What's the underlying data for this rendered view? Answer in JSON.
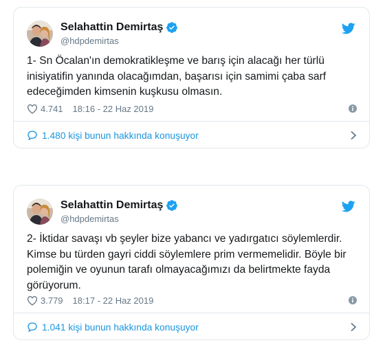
{
  "colors": {
    "brand": "#1da1f2",
    "link": "#1b95e0",
    "muted": "#657786",
    "border": "#e1e8ed",
    "text": "#14171a"
  },
  "tweets": [
    {
      "author_name": "Selahattin Demirtaş",
      "handle": "@hdpdemirtas",
      "text": "1- Sn Öcalan'ın demokratikleşme ve barış için alacağı her türlü\ninisiyatifin yanında olacağımdan, başarısı için samimi çaba sarf\nedeceğimden kimsenin kuşkusu olmasın.",
      "likes": "4.741",
      "timestamp": "18:16 - 22 Haz 2019",
      "conversation": "1.480 kişi bunun hakkında konuşuyor",
      "icons": [
        "avatar",
        "verified-icon",
        "twitter-bird-icon",
        "heart-icon",
        "info-icon",
        "reply-bubble-icon",
        "chevron-right-icon"
      ]
    },
    {
      "author_name": "Selahattin Demirtaş",
      "handle": "@hdpdemirtas",
      "text": "2- İktidar savaşı vb şeyler bize yabancı ve yadırgatıcı söylemlerdir.\nKimse bu türden gayri ciddi söylemlere prim vermemelidir. Böyle bir\npolemiğin ve oyunun tarafı olmayacağımızı da belirtmekte fayda\ngörüyorum.",
      "likes": "3.779",
      "timestamp": "18:17 - 22 Haz 2019",
      "conversation": "1.041 kişi bunun hakkında konuşuyor",
      "icons": [
        "avatar",
        "verified-icon",
        "twitter-bird-icon",
        "heart-icon",
        "info-icon",
        "reply-bubble-icon",
        "chevron-right-icon"
      ]
    }
  ]
}
